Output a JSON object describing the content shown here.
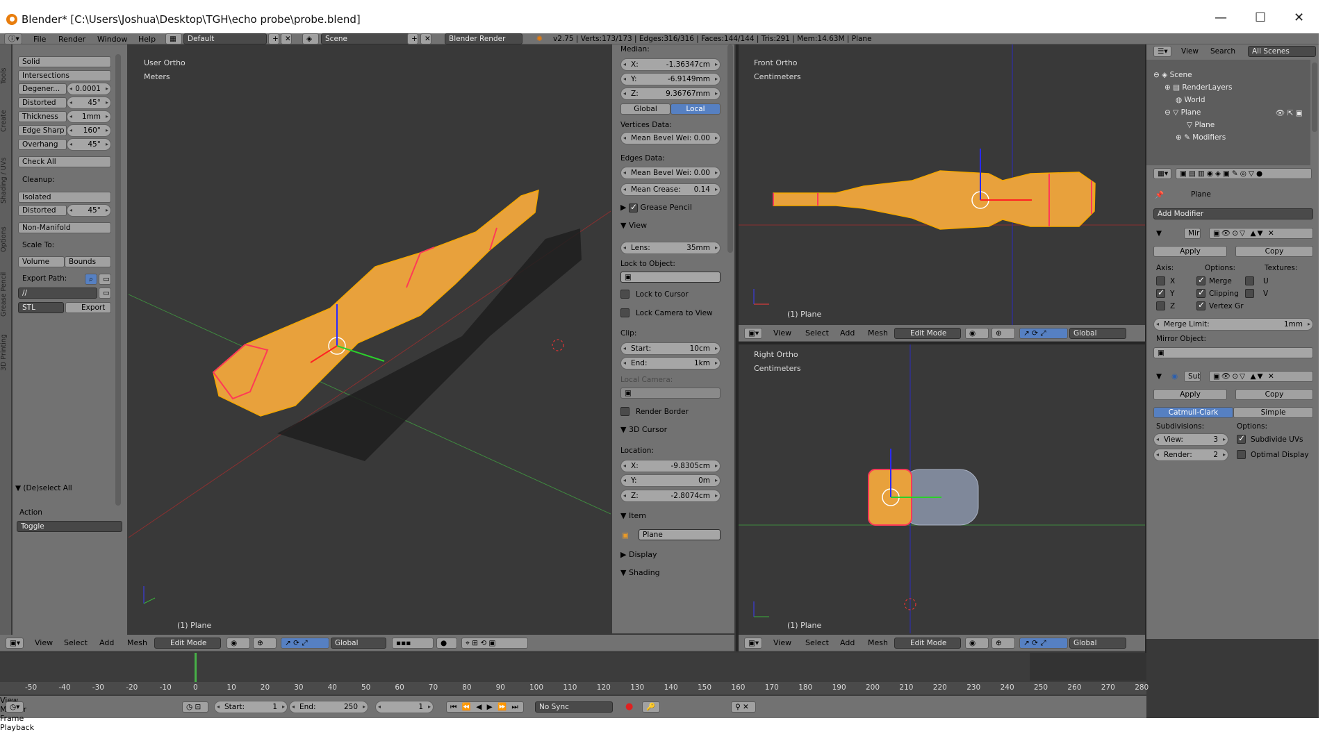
{
  "window": {
    "title": "Blender* [C:\\Users\\Joshua\\Desktop\\TGH\\echo probe\\probe.blend]",
    "minimize": "—",
    "maximize": "☐",
    "close": "✕"
  },
  "topbar": {
    "menus": [
      "File",
      "Render",
      "Window",
      "Help"
    ],
    "layout": "Default",
    "scene": "Scene",
    "engine": "Blender Render",
    "stats": "v2.75 | Verts:173/173 | Edges:316/316 | Faces:144/144 | Tris:291 | Mem:14.63M | Plane"
  },
  "tool_tabs": [
    "Tools",
    "Create",
    "Shading / UVs",
    "Options",
    "Grease Pencil",
    "3D Printing"
  ],
  "toolshelf": {
    "solid": "Solid",
    "intersections": "Intersections",
    "rows": [
      {
        "label": "Degener...",
        "value": "0.0001"
      },
      {
        "label": "Distorted",
        "value": "45°"
      },
      {
        "label": "Thickness",
        "value": "1mm"
      },
      {
        "label": "Edge Sharp",
        "value": "160°"
      },
      {
        "label": "Overhang",
        "value": "45°"
      }
    ],
    "check_all": "Check All",
    "cleanup": "Cleanup:",
    "isolated": "Isolated",
    "distorted_label": "Distorted",
    "distorted_value": "45°",
    "non_manifold": "Non-Manifold",
    "scale_to": "Scale To:",
    "volume": "Volume",
    "bounds": "Bounds",
    "export_path": "Export Path:",
    "path_value": "//",
    "format": "STL",
    "export": "Export",
    "operator_title": "(De)select All",
    "action_label": "Action",
    "action_value": "Toggle"
  },
  "viewport_main": {
    "view_name": "User Ortho",
    "units": "Meters",
    "object_label": "(1) Plane"
  },
  "npanel": {
    "median": "Median:",
    "coords": [
      {
        "axis": "X:",
        "value": "-1.36347cm"
      },
      {
        "axis": "Y:",
        "value": "-6.9149mm"
      },
      {
        "axis": "Z:",
        "value": "9.36767mm"
      }
    ],
    "global": "Global",
    "local": "Local",
    "vertices_data": "Vertices Data:",
    "mean_bevel_v": "Mean Bevel Wei: 0.00",
    "edges_data": "Edges Data:",
    "mean_bevel_e": "Mean Bevel Wei: 0.00",
    "mean_crease_label": "Mean Crease:",
    "mean_crease_value": "0.14",
    "grease_pencil": "Grease Pencil",
    "view": "View",
    "lens_label": "Lens:",
    "lens_value": "35mm",
    "lock_to_object": "Lock to Object:",
    "lock_to_cursor": "Lock to Cursor",
    "lock_camera": "Lock Camera to View",
    "clip": "Clip:",
    "clip_start_label": "Start:",
    "clip_start_value": "10cm",
    "clip_end_label": "End:",
    "clip_end_value": "1km",
    "local_camera": "Local Camera:",
    "render_border": "Render Border",
    "cursor_3d": "3D Cursor",
    "location": "Location:",
    "cursor": [
      {
        "axis": "X:",
        "value": "-9.8305cm"
      },
      {
        "axis": "Y:",
        "value": "0m"
      },
      {
        "axis": "Z:",
        "value": "-2.8074cm"
      }
    ],
    "item": "Item",
    "item_name": "Plane",
    "display": "Display",
    "shading": "Shading"
  },
  "viewport_front": {
    "view_name": "Front Ortho",
    "units": "Centimeters",
    "object_label": "(1) Plane"
  },
  "viewport_right": {
    "view_name": "Right Ortho",
    "units": "Centimeters",
    "object_label": "(1) Plane"
  },
  "vp_header": {
    "menus": [
      "View",
      "Select",
      "Add",
      "Mesh"
    ],
    "mode": "Edit Mode",
    "orientation": "Global"
  },
  "outliner": {
    "menus": [
      "View",
      "Search"
    ],
    "filter": "All Scenes",
    "items": [
      {
        "label": "Scene"
      },
      {
        "label": "RenderLayers"
      },
      {
        "label": "World"
      },
      {
        "label": "Plane"
      },
      {
        "label": "Plane"
      },
      {
        "label": "Modifiers"
      }
    ]
  },
  "properties": {
    "object": "Plane",
    "add_modifier": "Add Modifier",
    "mirror": {
      "name": "Mir",
      "apply": "Apply",
      "copy": "Copy",
      "axis": "Axis:",
      "options": "Options:",
      "textures": "Textures:",
      "x": "X",
      "y": "Y",
      "z": "Z",
      "merge": "Merge",
      "clipping": "Clipping",
      "vertex_gr": "Vertex Gr",
      "u": "U",
      "v": "V",
      "merge_limit_label": "Merge Limit:",
      "merge_limit_value": "1mm",
      "mirror_object": "Mirror Object:"
    },
    "subsurf": {
      "name": "Sub",
      "apply": "Apply",
      "copy": "Copy",
      "catmull": "Catmull-Clark",
      "simple": "Simple",
      "subdivisions": "Subdivisions:",
      "options": "Options:",
      "view_label": "View:",
      "view_value": "3",
      "render_label": "Render:",
      "render_value": "2",
      "subdivide_uvs": "Subdivide UVs",
      "optimal_display": "Optimal Display"
    }
  },
  "timeline": {
    "ticks": [
      "-50",
      "-40",
      "-30",
      "-20",
      "-10",
      "0",
      "10",
      "20",
      "30",
      "40",
      "50",
      "60",
      "70",
      "80",
      "90",
      "100",
      "110",
      "120",
      "130",
      "140",
      "150",
      "160",
      "170",
      "180",
      "190",
      "200",
      "210",
      "220",
      "230",
      "240",
      "250",
      "260",
      "270",
      "280"
    ],
    "current_frame": 1,
    "menus": [
      "View",
      "Marker",
      "Frame",
      "Playback"
    ],
    "start_label": "Start:",
    "start_value": "1",
    "end_label": "End:",
    "end_value": "250",
    "frame_value": "1",
    "sync": "No Sync"
  },
  "colors": {
    "ui_gray": "#727272",
    "viewport_bg": "#393939",
    "mesh_orange": "#e89a28",
    "wire_yellow": "#f5a700",
    "seam_red": "#ff3a56",
    "selected_blue": "#5680c2"
  }
}
